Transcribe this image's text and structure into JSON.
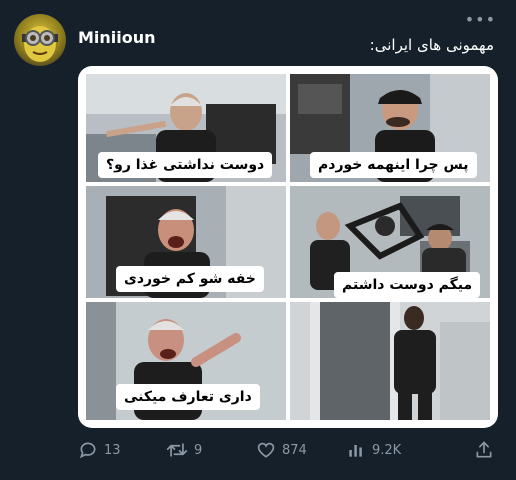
{
  "author": {
    "name": "Miniioun"
  },
  "more_label": "•••",
  "tweet": {
    "text": "مهمونی های ایرانی:"
  },
  "meme": {
    "captions": [
      "دوست نداشتی غذا رو؟",
      "پس چرا اینهمه خوردم",
      "خفه شو کم خوردی",
      "میگم دوست داشتم",
      "داری تعارف میکنی"
    ]
  },
  "actions": {
    "replies": "13",
    "retweets": "9",
    "likes": "874",
    "views": "9.2K"
  },
  "colors": {
    "background": "#15202b",
    "text_secondary": "#8b98a5"
  }
}
